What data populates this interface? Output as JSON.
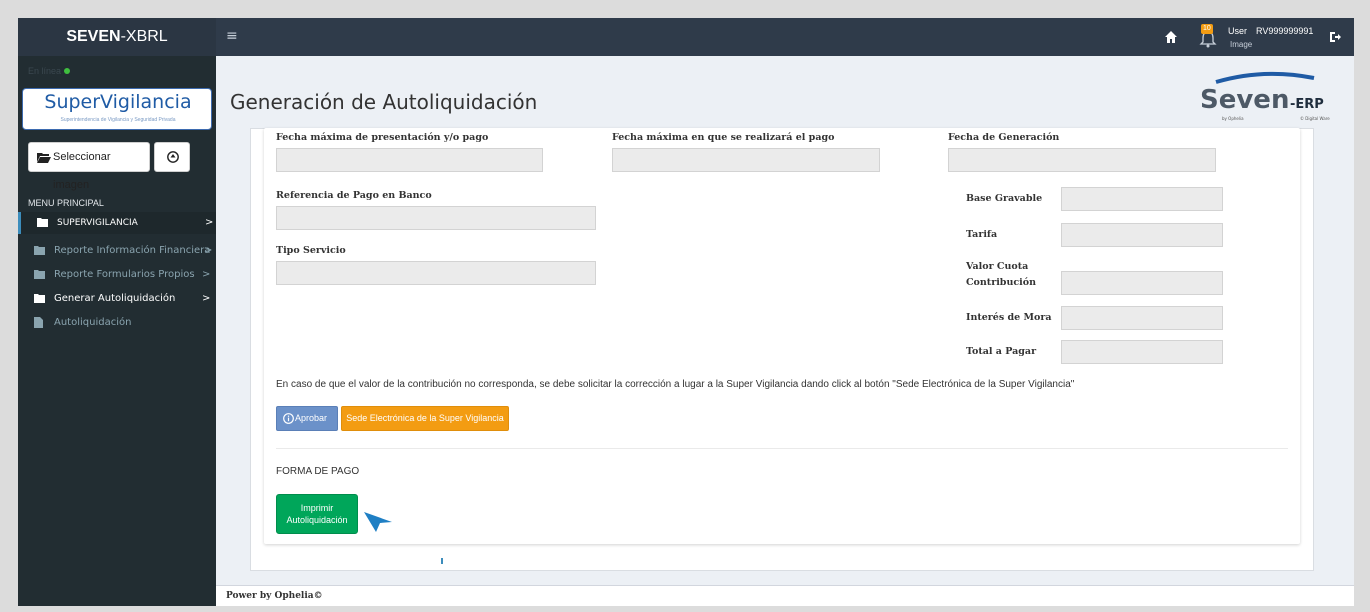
{
  "header": {
    "brand_part1": "SEVEN",
    "brand_part2": "-XBRL",
    "menu_icon": "≡",
    "notification_count": "10",
    "user_label": "User",
    "user_id": "RV999999991",
    "user_image_label": "Image"
  },
  "sidebar": {
    "status_text": "En línea",
    "logo_text": "SuperVigilancia",
    "logo_subtext": "Superintendencia de Vigilancia y Seguridad Privada",
    "select_image_label": "Seleccionar imagen",
    "menu_header": "MENU PRINCIPAL",
    "items": [
      {
        "label": "SUPERVIGILANCIA",
        "chevron": ">"
      },
      {
        "label": "Reporte Información Financiera",
        "chevron": ">"
      },
      {
        "label": "Reporte Formularios Propios",
        "chevron": ">"
      },
      {
        "label": "Generar Autoliquidación",
        "chevron": ">"
      },
      {
        "label": "Autoliquidación"
      }
    ]
  },
  "main": {
    "title": "Generación de Autoliquidación",
    "seven_logo_text": "Seven",
    "seven_logo_suffix": "-ERP",
    "seven_logo_by": "by Ophelia",
    "seven_logo_dw": "© Digital Ware",
    "form": {
      "fecha_max_presentacion_label": "Fecha máxima de presentación y/o pago",
      "fecha_max_pago_label": "Fecha máxima en que se realizará el pago",
      "fecha_generacion_label": "Fecha de Generación",
      "referencia_pago_label": "Referencia de Pago en Banco",
      "tipo_servicio_label": "Tipo Servicio",
      "base_gravable_label": "Base Gravable",
      "tarifa_label": "Tarifa",
      "valor_cuota_label_1": "Valor Cuota",
      "valor_cuota_label_2": "Contribución",
      "interes_mora_label": "Interés de Mora",
      "total_pagar_label": "Total a Pagar"
    },
    "note": "En caso de que el valor de la contribución no corresponda, se debe solicitar la corrección a lugar a la Super Vigilancia dando click al botón \"Sede Electrónica de la Super Vigilancia\"",
    "aprobar_label": "Aprobar",
    "sede_label": "Sede Electrónica de la Super Vigilancia",
    "forma_pago_label": "FORMA DE PAGO",
    "imprimir_line1": "Imprimir",
    "imprimir_line2": "Autoliquidación"
  },
  "footer": {
    "text": "Power by Ophelia©"
  },
  "colors": {
    "topbar": "#2f3b4a",
    "sidebar": "#222d32",
    "accent_blue": "#3c8dbc",
    "aprobar": "#6b91c9",
    "sede": "#f39c12",
    "imprimir": "#00a65a"
  },
  "icons": [
    "menu-icon",
    "home-icon",
    "bell-icon",
    "logout-icon",
    "folder-icon",
    "up-circle-icon",
    "file-icon",
    "info-icon",
    "pointer-arrow-icon"
  ]
}
